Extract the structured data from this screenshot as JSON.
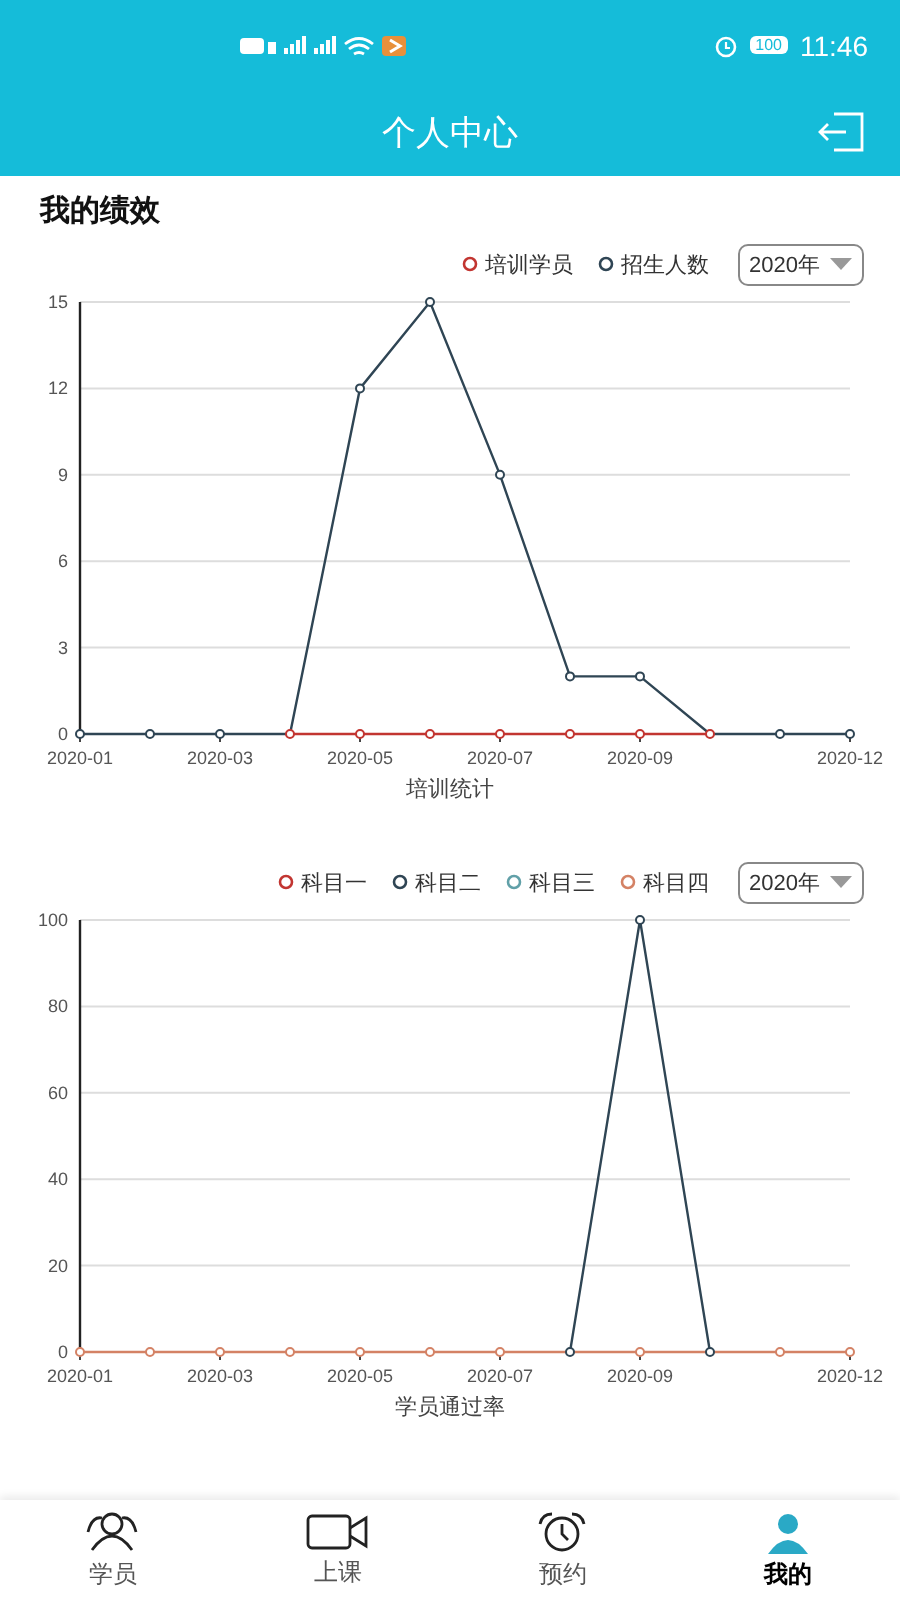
{
  "status_bar": {
    "battery": "100",
    "time": "11:46"
  },
  "header": {
    "title": "个人中心"
  },
  "section_title": "我的绩效",
  "charts": [
    {
      "year_select": "2020年",
      "chart_data": {
        "type": "line",
        "title": "培训统计",
        "categories": [
          "2020-01",
          null,
          "2020-03",
          null,
          "2020-05",
          null,
          "2020-07",
          null,
          "2020-09",
          null,
          null,
          "2020-12"
        ],
        "ylim": [
          0,
          15
        ],
        "grid": true,
        "yticks": [
          0,
          3,
          6,
          9,
          12,
          15
        ],
        "series": [
          {
            "name": "培训学员",
            "color": "#c23531",
            "marker": "circle",
            "values": [
              null,
              null,
              null,
              0,
              0,
              0,
              0,
              0,
              0,
              0,
              null,
              null
            ]
          },
          {
            "name": "招生人数",
            "color": "#2f4554",
            "marker": "circle",
            "values": [
              0,
              0,
              0,
              0,
              12,
              15,
              9,
              2,
              2,
              0,
              0,
              0
            ]
          }
        ]
      }
    },
    {
      "year_select": "2020年",
      "chart_data": {
        "type": "line",
        "title": "学员通过率",
        "categories": [
          "2020-01",
          null,
          "2020-03",
          null,
          "2020-05",
          null,
          "2020-07",
          null,
          "2020-09",
          null,
          null,
          "2020-12"
        ],
        "ylim": [
          0,
          100
        ],
        "grid": true,
        "yticks": [
          0,
          20,
          40,
          60,
          80,
          100
        ],
        "series": [
          {
            "name": "科目一",
            "color": "#c23531",
            "marker": "circle",
            "values": [
              null,
              null,
              null,
              null,
              null,
              null,
              null,
              null,
              null,
              null,
              null,
              null
            ]
          },
          {
            "name": "科目二",
            "color": "#2f4554",
            "marker": "circle",
            "values": [
              null,
              null,
              null,
              null,
              null,
              null,
              null,
              0,
              100,
              0,
              null,
              null
            ]
          },
          {
            "name": "科目三",
            "color": "#61a0a8",
            "marker": "circle",
            "values": [
              null,
              null,
              null,
              null,
              null,
              null,
              null,
              null,
              null,
              null,
              null,
              null
            ]
          },
          {
            "name": "科目四",
            "color": "#d48265",
            "marker": "circle",
            "values": [
              0,
              0,
              0,
              0,
              0,
              0,
              0,
              0,
              0,
              0,
              0,
              0
            ]
          }
        ]
      }
    }
  ],
  "tabs": [
    {
      "label": "学员",
      "selected": false
    },
    {
      "label": "上课",
      "selected": false
    },
    {
      "label": "预约",
      "selected": false
    },
    {
      "label": "我的",
      "selected": true
    }
  ]
}
